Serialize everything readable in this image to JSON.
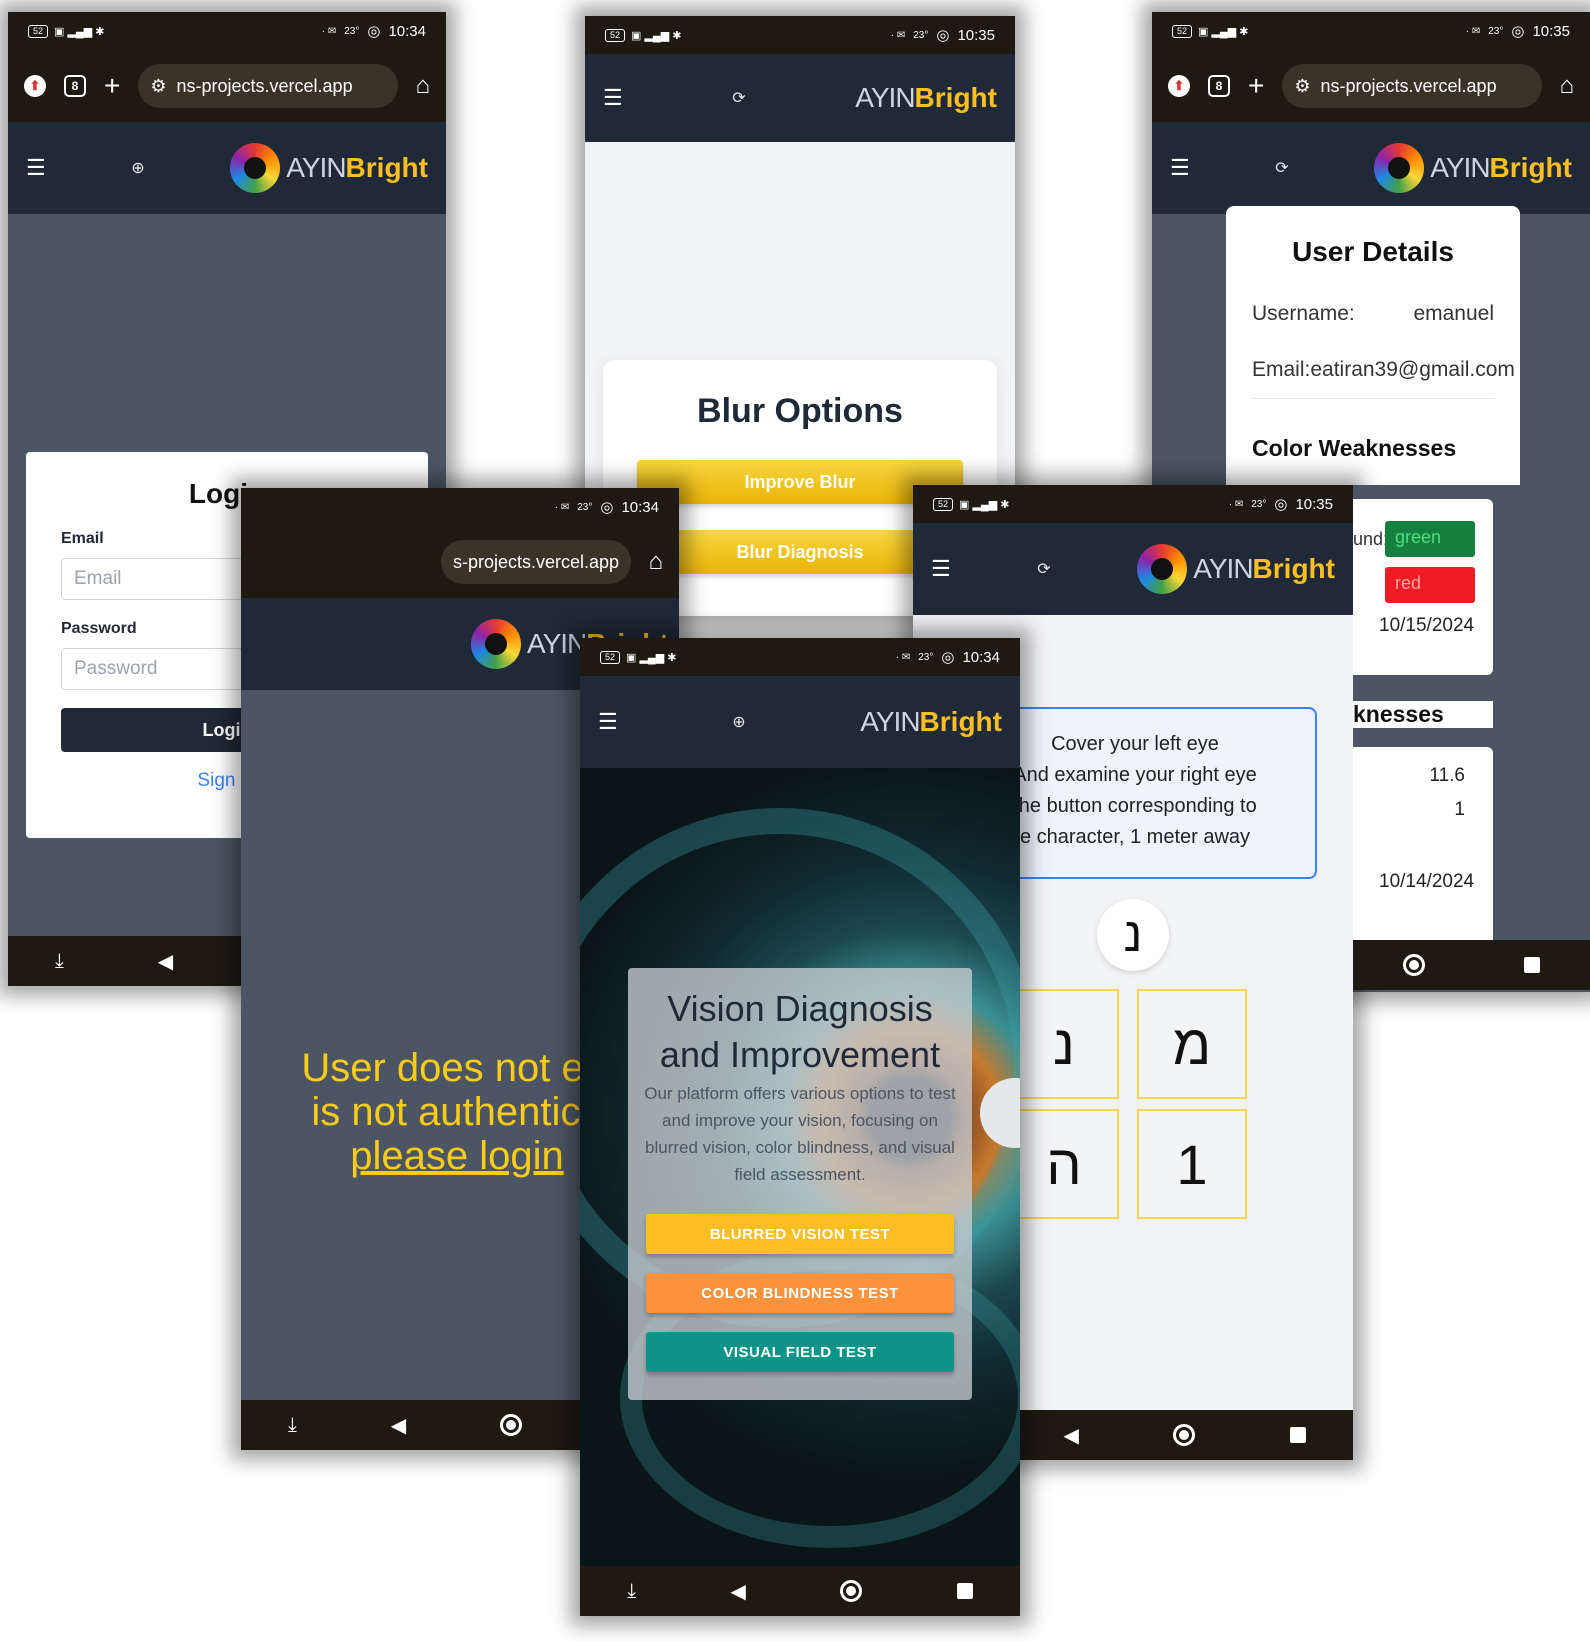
{
  "status": {
    "left_icons": "5G",
    "battery": "52",
    "temp": "23°"
  },
  "brand": {
    "ayin": "AYIN",
    "bright": "Bright"
  },
  "browser": {
    "url": "ns-projects.vercel.app",
    "tabs": "8"
  },
  "screen_login": {
    "time": "10:34",
    "title": "Login",
    "email_label": "Email",
    "email_placeholder": "Email",
    "password_label": "Password",
    "password_placeholder": "Password",
    "login_button": "Login",
    "signin_link": "Sign In"
  },
  "screen_unauth": {
    "time": "10:34",
    "url_fragment": "s-projects.vercel.app",
    "brand_fragment": "AYINBright",
    "msg_line1": "User does not exi",
    "msg_line2": "is not authentica",
    "msg_link": "please login"
  },
  "screen_blur": {
    "time": "10:35",
    "title": "Blur Options",
    "btn_improve": "Improve Blur",
    "btn_diagnosis": "Blur Diagnosis"
  },
  "screen_user": {
    "time": "10:35",
    "title": "User Details",
    "username_label": "Username:",
    "username_value": "emanuel",
    "email_text": "Email:eatiran39@gmail.com",
    "color_heading": "Color Weaknesses",
    "row_partial": "und:",
    "chip_green": "green",
    "chip_red": "red",
    "date1": "10/15/2024",
    "weak_heading": "knesses",
    "val1_prefix": ":",
    "val1": "11.6",
    "val2_prefix": ":",
    "val2": "1",
    "date2": "10/14/2024",
    "colors": {
      "green": "#15803d",
      "red": "#ef1c24"
    }
  },
  "screen_vision": {
    "time": "10:35",
    "instr_line1": "Cover your left eye",
    "instr_line2": "And examine your right eye",
    "instr_line3": "the button corresponding to",
    "instr_line4": "e character, 1 meter away",
    "target_char": "נ",
    "options": [
      "נ",
      "מ",
      "ה",
      "1"
    ]
  },
  "screen_home": {
    "time": "10:34",
    "title_line1": "Vision Diagnosis",
    "title_line2": "and Improvement",
    "description": "Our platform offers various options to test and improve your vision, focusing on blurred vision, color blindness, and visual field assessment.",
    "btn_blur": "BLURRED VISION TEST",
    "btn_color": "COLOR BLINDNESS TEST",
    "btn_field": "VISUAL FIELD TEST",
    "colors": {
      "blur": "#fbbf24",
      "color": "#fb923c",
      "field": "#0d9488"
    }
  }
}
